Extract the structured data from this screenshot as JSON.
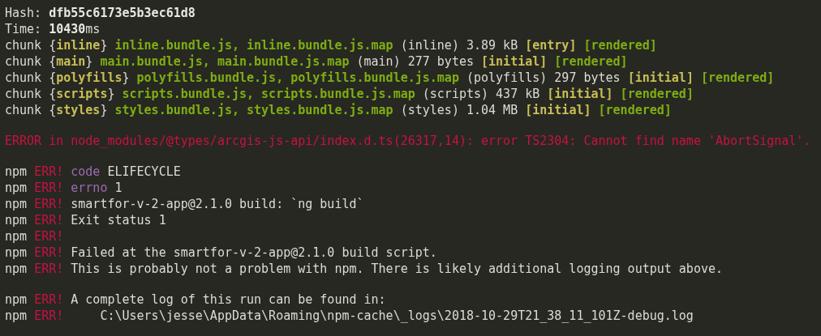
{
  "terminal": {
    "lines": [
      {
        "kind": "text",
        "segments": [
          {
            "text": "Hash: ",
            "kind": "plain"
          },
          {
            "text": "dfb55c6173e5b3ec61d8",
            "kind": "value"
          }
        ]
      },
      {
        "kind": "text",
        "segments": [
          {
            "text": "Time: ",
            "kind": "plain"
          },
          {
            "text": "10430",
            "kind": "value"
          },
          {
            "text": "ms",
            "kind": "plain"
          }
        ]
      },
      {
        "kind": "text",
        "segments": [
          {
            "text": "chunk {",
            "kind": "plain"
          },
          {
            "text": "inline",
            "kind": "name"
          },
          {
            "text": "} ",
            "kind": "plain"
          },
          {
            "text": "inline.bundle.js, inline.bundle.js.map",
            "kind": "file"
          },
          {
            "text": " (inline) 3.89 kB ",
            "kind": "plain"
          },
          {
            "text": "[entry]",
            "kind": "tag"
          },
          {
            "text": " [rendered]",
            "kind": "status"
          }
        ]
      },
      {
        "kind": "text",
        "segments": [
          {
            "text": "chunk {",
            "kind": "plain"
          },
          {
            "text": "main",
            "kind": "name"
          },
          {
            "text": "} ",
            "kind": "plain"
          },
          {
            "text": "main.bundle.js, main.bundle.js.map",
            "kind": "file"
          },
          {
            "text": " (main) 277 bytes ",
            "kind": "plain"
          },
          {
            "text": "[initial]",
            "kind": "tag"
          },
          {
            "text": " [rendered]",
            "kind": "status"
          }
        ]
      },
      {
        "kind": "text",
        "segments": [
          {
            "text": "chunk {",
            "kind": "plain"
          },
          {
            "text": "polyfills",
            "kind": "name"
          },
          {
            "text": "} ",
            "kind": "plain"
          },
          {
            "text": "polyfills.bundle.js, polyfills.bundle.js.map",
            "kind": "file"
          },
          {
            "text": " (polyfills) 297 bytes ",
            "kind": "plain"
          },
          {
            "text": "[initial]",
            "kind": "tag"
          },
          {
            "text": " [rendered]",
            "kind": "status"
          }
        ]
      },
      {
        "kind": "text",
        "segments": [
          {
            "text": "chunk {",
            "kind": "plain"
          },
          {
            "text": "scripts",
            "kind": "name"
          },
          {
            "text": "} ",
            "kind": "plain"
          },
          {
            "text": "scripts.bundle.js, scripts.bundle.js.map",
            "kind": "file"
          },
          {
            "text": " (scripts) 437 kB ",
            "kind": "plain"
          },
          {
            "text": "[initial]",
            "kind": "tag"
          },
          {
            "text": " [rendered]",
            "kind": "status"
          }
        ]
      },
      {
        "kind": "text",
        "segments": [
          {
            "text": "chunk {",
            "kind": "plain"
          },
          {
            "text": "styles",
            "kind": "name"
          },
          {
            "text": "} ",
            "kind": "plain"
          },
          {
            "text": "styles.bundle.js, styles.bundle.js.map",
            "kind": "file"
          },
          {
            "text": " (styles) 1.04 MB ",
            "kind": "plain"
          },
          {
            "text": "[initial]",
            "kind": "tag"
          },
          {
            "text": " [rendered]",
            "kind": "status"
          }
        ]
      },
      {
        "kind": "blank"
      },
      {
        "kind": "text",
        "segments": [
          {
            "text": "ERROR in node_modules/@types/arcgis-js-api/index.d.ts(26317,14): error TS2304: Cannot find name 'AbortSignal'.",
            "kind": "error"
          }
        ]
      },
      {
        "kind": "blank"
      },
      {
        "kind": "text",
        "segments": [
          {
            "text": "npm ",
            "kind": "plain"
          },
          {
            "text": "ERR!",
            "kind": "err"
          },
          {
            "text": " code",
            "kind": "keyword"
          },
          {
            "text": " ELIFECYCLE",
            "kind": "plain"
          }
        ]
      },
      {
        "kind": "text",
        "segments": [
          {
            "text": "npm ",
            "kind": "plain"
          },
          {
            "text": "ERR!",
            "kind": "err"
          },
          {
            "text": " errno",
            "kind": "keyword"
          },
          {
            "text": " 1",
            "kind": "plain"
          }
        ]
      },
      {
        "kind": "text",
        "segments": [
          {
            "text": "npm ",
            "kind": "plain"
          },
          {
            "text": "ERR!",
            "kind": "err"
          },
          {
            "text": " smartfor-v-2-app@2.1.0 build: `ng build`",
            "kind": "plain"
          }
        ]
      },
      {
        "kind": "text",
        "segments": [
          {
            "text": "npm ",
            "kind": "plain"
          },
          {
            "text": "ERR!",
            "kind": "err"
          },
          {
            "text": " Exit status 1",
            "kind": "plain"
          }
        ]
      },
      {
        "kind": "text",
        "segments": [
          {
            "text": "npm ",
            "kind": "plain"
          },
          {
            "text": "ERR!",
            "kind": "err"
          }
        ]
      },
      {
        "kind": "text",
        "segments": [
          {
            "text": "npm ",
            "kind": "plain"
          },
          {
            "text": "ERR!",
            "kind": "err"
          },
          {
            "text": " Failed at the smartfor-v-2-app@2.1.0 build script.",
            "kind": "plain"
          }
        ]
      },
      {
        "kind": "text",
        "segments": [
          {
            "text": "npm ",
            "kind": "plain"
          },
          {
            "text": "ERR!",
            "kind": "err"
          },
          {
            "text": " This is probably not a problem with npm. There is likely additional logging output above.",
            "kind": "plain"
          }
        ]
      },
      {
        "kind": "blank"
      },
      {
        "kind": "text",
        "segments": [
          {
            "text": "npm ",
            "kind": "plain"
          },
          {
            "text": "ERR!",
            "kind": "err"
          },
          {
            "text": " A complete log of this run can be found in:",
            "kind": "plain"
          }
        ]
      },
      {
        "kind": "text",
        "segments": [
          {
            "text": "npm ",
            "kind": "plain"
          },
          {
            "text": "ERR!",
            "kind": "err"
          },
          {
            "text": "     C:\\Users\\jesse\\AppData\\Roaming\\npm-cache\\_logs\\2018-10-29T21_38_11_101Z-debug.log",
            "kind": "plain"
          }
        ]
      }
    ]
  }
}
